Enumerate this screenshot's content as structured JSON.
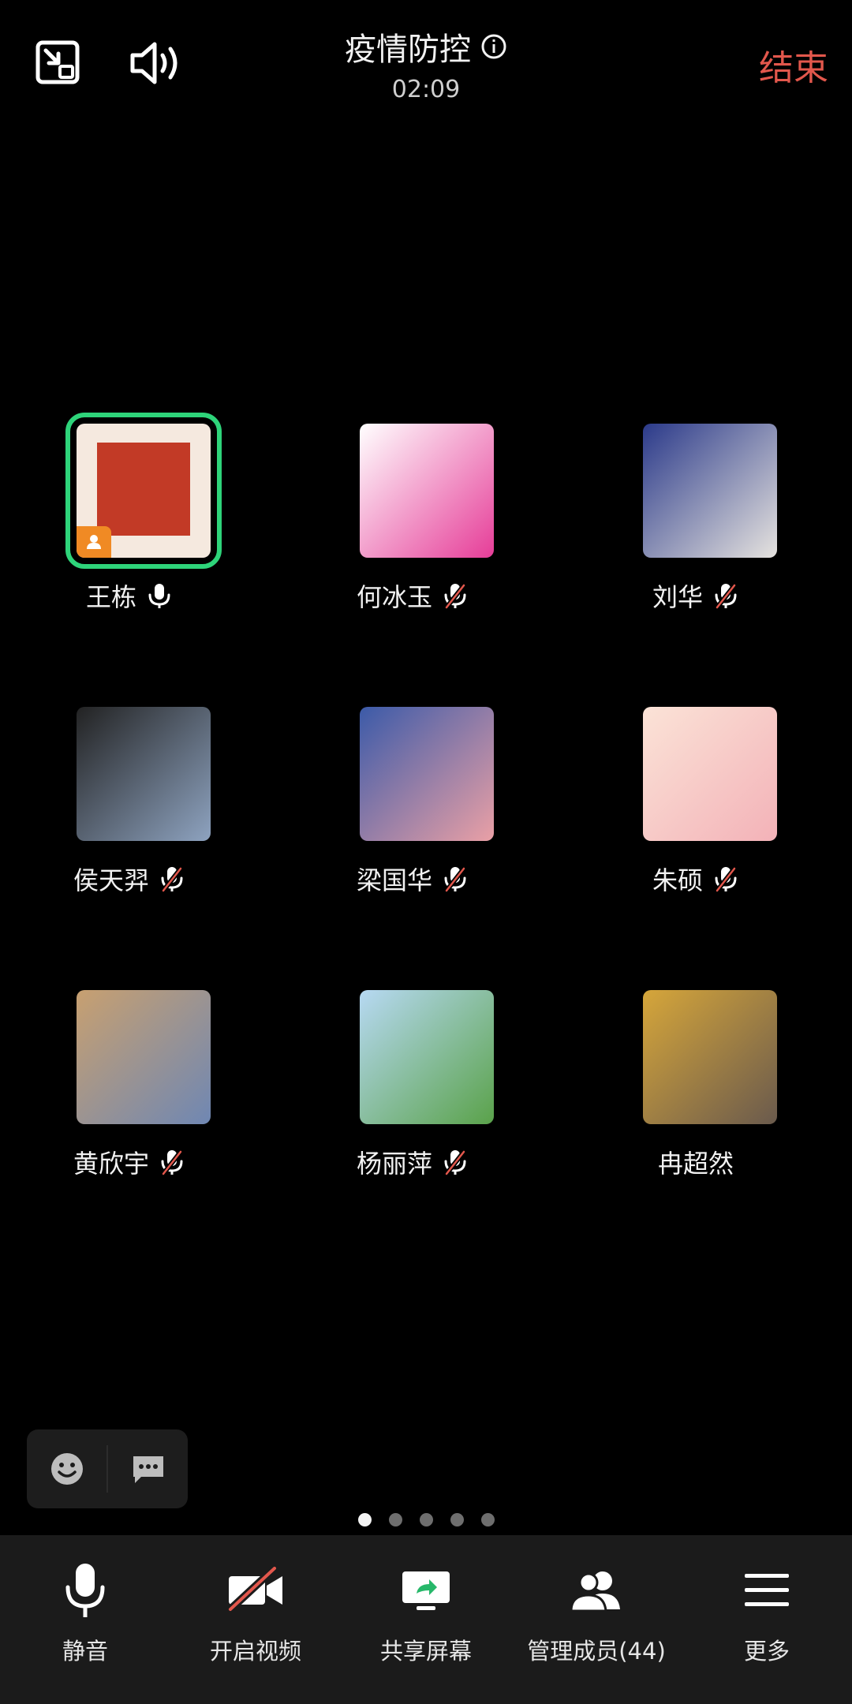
{
  "header": {
    "title": "疫情防控",
    "timer": "02:09",
    "end_label": "结束"
  },
  "participants": [
    {
      "name": "王栋",
      "muted": false,
      "host": true,
      "active": true,
      "avatar_colors": [
        "#c23a26",
        "#f5e9df"
      ]
    },
    {
      "name": "何冰玉",
      "muted": true,
      "avatar_colors": [
        "#e63d98",
        "#ffffff"
      ]
    },
    {
      "name": "刘华",
      "muted": true,
      "avatar_colors": [
        "#e6e3df",
        "#2b3a8a"
      ]
    },
    {
      "name": "侯天羿",
      "muted": true,
      "avatar_colors": [
        "#8ea3c0",
        "#222222"
      ]
    },
    {
      "name": "梁国华",
      "muted": true,
      "avatar_colors": [
        "#eaa0a6",
        "#3b5aa8"
      ]
    },
    {
      "name": "朱硕",
      "muted": true,
      "avatar_colors": [
        "#f3b2b8",
        "#fbe3d7"
      ]
    },
    {
      "name": "黄欣宇",
      "muted": true,
      "avatar_colors": [
        "#6f87b3",
        "#c8a070"
      ]
    },
    {
      "name": "杨丽萍",
      "muted": true,
      "avatar_colors": [
        "#5aa24a",
        "#b7d9f3"
      ]
    },
    {
      "name": "冉超然",
      "muted": null,
      "avatar_colors": [
        "#6a5a4d",
        "#d6a63a"
      ]
    }
  ],
  "pager": {
    "count": 5,
    "current": 1
  },
  "bottom_bar": [
    {
      "label": "静音",
      "icon": "microphone-icon"
    },
    {
      "label": "开启视频",
      "icon": "video-off-icon"
    },
    {
      "label": "共享屏幕",
      "icon": "share-screen-icon"
    },
    {
      "label": "管理成员(44)",
      "icon": "members-icon"
    },
    {
      "label": "更多",
      "icon": "menu-icon"
    }
  ],
  "colors": {
    "end": "#e2574c",
    "active_ring": "#2ed47a",
    "bottom_bg": "#1b1b1b"
  }
}
